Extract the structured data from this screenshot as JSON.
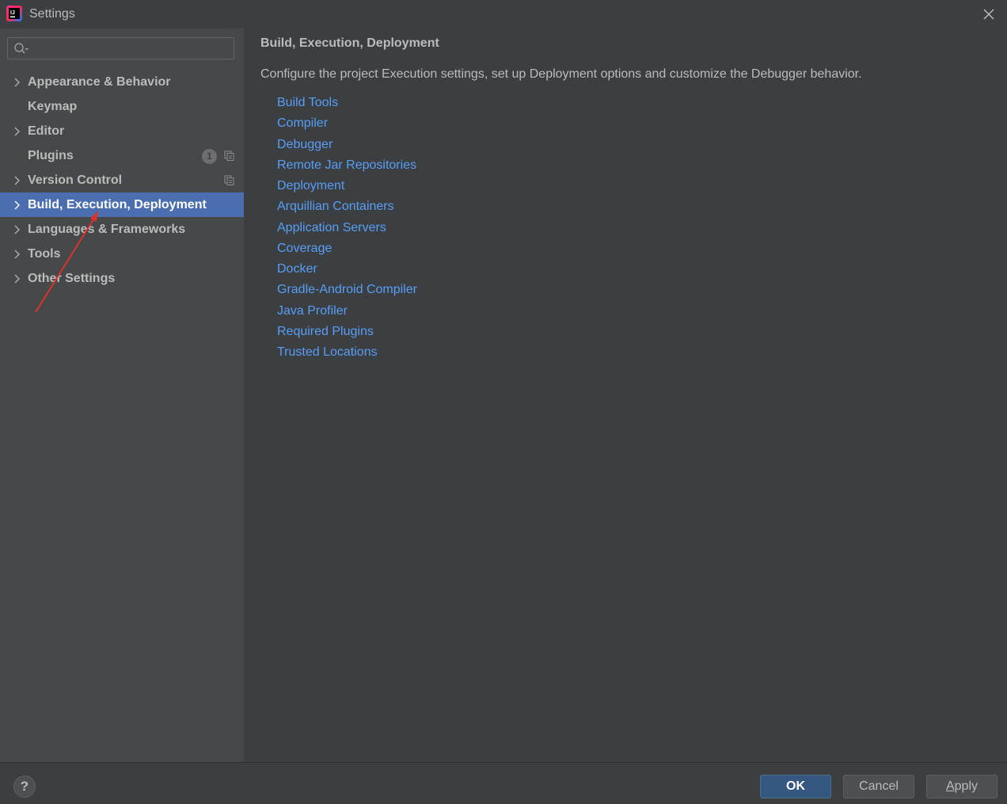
{
  "window": {
    "title": "Settings"
  },
  "search": {
    "placeholder": "",
    "value": ""
  },
  "sidebar": {
    "items": [
      {
        "label": "Appearance & Behavior",
        "has_children": true
      },
      {
        "label": "Keymap",
        "has_children": false
      },
      {
        "label": "Editor",
        "has_children": true
      },
      {
        "label": "Plugins",
        "has_children": false,
        "badge": "1"
      },
      {
        "label": "Version Control",
        "has_children": true
      },
      {
        "label": "Build, Execution, Deployment",
        "has_children": true,
        "selected": true
      },
      {
        "label": "Languages & Frameworks",
        "has_children": true
      },
      {
        "label": "Tools",
        "has_children": true
      },
      {
        "label": "Other Settings",
        "has_children": true
      }
    ]
  },
  "main": {
    "title": "Build, Execution, Deployment",
    "description": "Configure the project Execution settings, set up Deployment options and customize the Debugger behavior.",
    "links": [
      "Build Tools",
      "Compiler",
      "Debugger",
      "Remote Jar Repositories",
      "Deployment",
      "Arquillian Containers",
      "Application Servers",
      "Coverage",
      "Docker",
      "Gradle-Android Compiler",
      "Java Profiler",
      "Required Plugins",
      "Trusted Locations"
    ]
  },
  "footer": {
    "help_label": "?",
    "ok_label": "OK",
    "cancel_label": "Cancel",
    "apply_mnemonic": "A",
    "apply_rest": "pply"
  },
  "colors": {
    "background": "#3c3f41",
    "sidebar_bg": "#45494a",
    "selection": "#4b6eaf",
    "link": "#589df6",
    "primary_button": "#365880",
    "annotation_arrow": "#e0302a"
  }
}
